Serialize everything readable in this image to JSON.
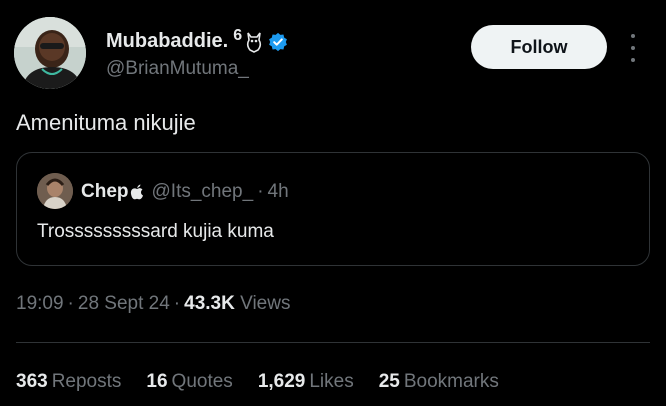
{
  "author": {
    "display_name": "Mubabaddie.",
    "name_extra": "6",
    "handle": "@BrianMutuma_"
  },
  "follow_label": "Follow",
  "tweet_text": "Amenituma nikujie",
  "quote": {
    "name": "Chep",
    "handle": "@Its_chep_",
    "separator": "·",
    "time": "4h",
    "text": "Trosssssssssard kujia kuma"
  },
  "meta": {
    "time": "19:09",
    "sep1": "·",
    "date": "28 Sept 24",
    "sep2": "·",
    "views_count": "43.3K",
    "views_label": "Views"
  },
  "stats": [
    {
      "count": "363",
      "label": "Reposts"
    },
    {
      "count": "16",
      "label": "Quotes"
    },
    {
      "count": "1,629",
      "label": "Likes"
    },
    {
      "count": "25",
      "label": "Bookmarks"
    }
  ],
  "colors": {
    "background": "#000000",
    "primary_text": "#e7e9ea",
    "secondary_text": "#71767b",
    "border": "#2f3336",
    "verified": "#1d9bf0",
    "follow_bg": "#eff3f4"
  },
  "icons": {
    "owl": "owl-icon",
    "verified": "verified-badge-icon",
    "apple": "apple-icon",
    "more": "more-options-icon"
  }
}
